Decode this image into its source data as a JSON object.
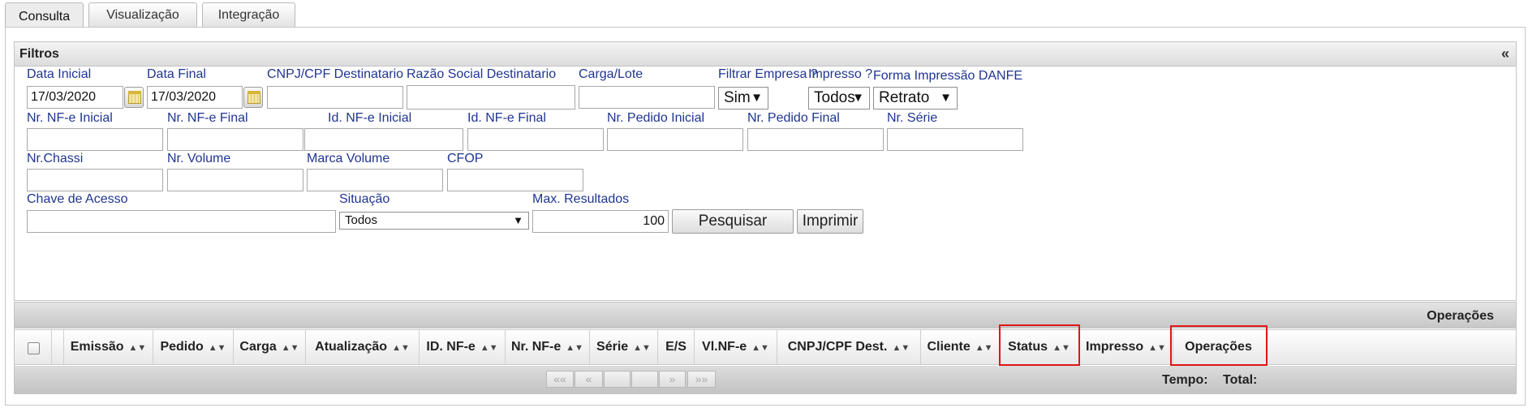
{
  "tabs": [
    {
      "label": "Consulta"
    },
    {
      "label": "Visualização"
    },
    {
      "label": "Integração"
    }
  ],
  "filters": {
    "title": "Filtros",
    "collapse_glyph": "«",
    "fields": {
      "data_inicial": {
        "label": "Data Inicial",
        "value": "17/03/2020"
      },
      "data_final": {
        "label": "Data Final",
        "value": "17/03/2020"
      },
      "cnpj_cpf": {
        "label": "CNPJ/CPF Destinatario",
        "value": ""
      },
      "razao_social": {
        "label": "Razão Social Destinatario",
        "value": ""
      },
      "carga_lote": {
        "label": "Carga/Lote",
        "value": ""
      },
      "filtrar_empresa": {
        "label": "Filtrar Empresa ?",
        "value": "Sim"
      },
      "impresso": {
        "label": "Impresso ?",
        "value": "Todos"
      },
      "forma_impressao": {
        "label": "Forma Impressão DANFE",
        "value": "Retrato"
      },
      "nfe_inicial": {
        "label": "Nr. NF-e Inicial",
        "value": ""
      },
      "nfe_final": {
        "label": "Nr. NF-e Final",
        "value": ""
      },
      "id_nfe_inicial": {
        "label": "Id. NF-e Inicial",
        "value": ""
      },
      "id_nfe_final": {
        "label": "Id. NF-e Final",
        "value": ""
      },
      "pedido_inicial": {
        "label": "Nr. Pedido Inicial",
        "value": ""
      },
      "pedido_final": {
        "label": "Nr. Pedido Final",
        "value": ""
      },
      "serie": {
        "label": "Nr. Série",
        "value": ""
      },
      "chassi": {
        "label": "Nr.Chassi",
        "value": ""
      },
      "volume": {
        "label": "Nr. Volume",
        "value": ""
      },
      "marca_volume": {
        "label": "Marca Volume",
        "value": ""
      },
      "cfop": {
        "label": "CFOP",
        "value": ""
      },
      "chave_acesso": {
        "label": "Chave de Acesso",
        "value": ""
      },
      "situacao": {
        "label": "Situação",
        "value": "Todos"
      },
      "max_resultados": {
        "label": "Max. Resultados",
        "value": "100"
      }
    },
    "buttons": {
      "pesquisar": "Pesquisar",
      "imprimir": "Imprimir"
    }
  },
  "grid": {
    "operations_label": "Operações",
    "columns": [
      "Emissão",
      "Pedido",
      "Carga",
      "Atualização",
      "ID. NF-e",
      "Nr. NF-e",
      "Série",
      "E/S",
      "Vl.NF-e",
      "CNPJ/CPF Dest.",
      "Cliente",
      "Status",
      "Impresso",
      "Operações"
    ],
    "pager": {
      "first": "««",
      "prev": "«",
      "next": "»",
      "last": "»»"
    },
    "footer": {
      "tempo": "Tempo:",
      "total": "Total:"
    }
  },
  "colors": {
    "label_blue": "#1f3592",
    "highlight_red": "#e01515"
  }
}
